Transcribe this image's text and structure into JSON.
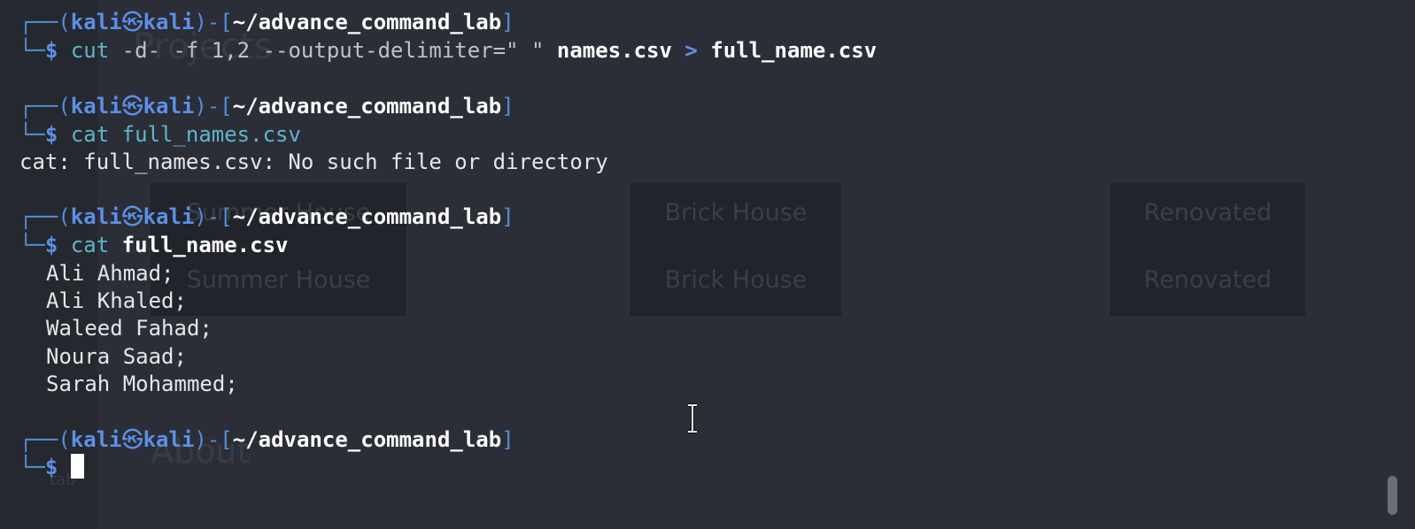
{
  "prompt": {
    "user": "kali",
    "skull": "㉿",
    "host": "kali",
    "cwd": "~/advance_command_lab",
    "symbol": "$"
  },
  "background": {
    "projects": "Projects",
    "tiles": [
      {
        "title": "Summer House",
        "subtitle": "Summer House"
      },
      {
        "title": "Brick House",
        "subtitle": "Brick House"
      },
      {
        "title": "Renovated",
        "subtitle": "Renovated"
      }
    ],
    "about": "About",
    "tab": "tab"
  },
  "session": [
    {
      "command": {
        "program": "cut",
        "options": "-d- -f 1,2 --output-delimiter=\" \"",
        "input": "names.csv",
        "redirect": ">",
        "output": "full_name.csv"
      }
    },
    {
      "command": {
        "program": "cat",
        "arg": "full_names.csv"
      },
      "output": [
        "cat: full_names.csv: No such file or directory"
      ]
    },
    {
      "command": {
        "program": "cat",
        "arg": "full_name.csv"
      },
      "output": [
        "Ali Ahmad;",
        "Ali Khaled;",
        "Waleed Fahad;",
        "Noura Saad;",
        "Sarah Mohammed;"
      ]
    }
  ],
  "colors": {
    "background": "#2b2e37",
    "prompt_blue": "#5c8fe6",
    "command_cyan": "#5fb3c8",
    "text": "#e6e6e6"
  }
}
